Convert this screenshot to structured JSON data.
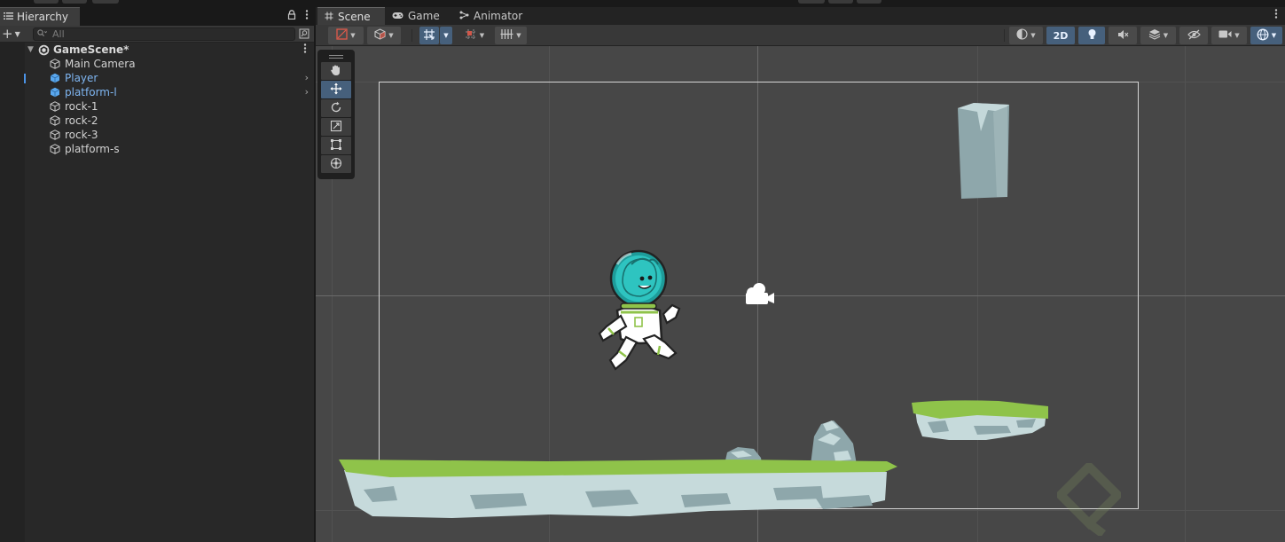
{
  "hierarchy": {
    "tab_title": "Hierarchy",
    "search_placeholder": "All",
    "scene_name": "GameScene*",
    "items": [
      {
        "label": "Main Camera",
        "prefab": false,
        "has_children": false
      },
      {
        "label": "Player",
        "prefab": true,
        "has_children": true
      },
      {
        "label": "platform-l",
        "prefab": true,
        "has_children": true
      },
      {
        "label": "rock-1",
        "prefab": false,
        "has_children": false
      },
      {
        "label": "rock-2",
        "prefab": false,
        "has_children": false
      },
      {
        "label": "rock-3",
        "prefab": false,
        "has_children": false
      },
      {
        "label": "platform-s",
        "prefab": false,
        "has_children": false
      }
    ]
  },
  "scene_view": {
    "tabs": [
      {
        "label": "Scene",
        "icon": "hash-grid-icon",
        "active": true
      },
      {
        "label": "Game",
        "icon": "gamepad-icon",
        "active": false
      },
      {
        "label": "Animator",
        "icon": "animator-icon",
        "active": false
      }
    ],
    "toolbar": {
      "mode_2d_label": "2D"
    },
    "tools": [
      {
        "name": "hand-tool",
        "active": false
      },
      {
        "name": "move-tool",
        "active": true
      },
      {
        "name": "rotate-tool",
        "active": false
      },
      {
        "name": "scale-tool",
        "active": false
      },
      {
        "name": "rect-tool",
        "active": false
      },
      {
        "name": "transform-tool",
        "active": false
      }
    ]
  },
  "colors": {
    "accent": "#46607c",
    "prefab_text": "#7fb6f2",
    "grass": "#8fc34a",
    "rock": "#b9d0d2",
    "helmet": "#2ec4c0"
  }
}
